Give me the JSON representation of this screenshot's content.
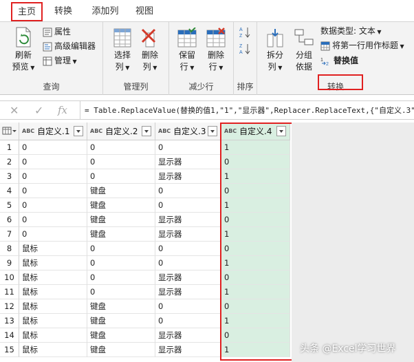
{
  "tabs": [
    "主页",
    "转换",
    "添加列",
    "视图"
  ],
  "ribbon": {
    "query": {
      "refresh_line1": "刷新",
      "refresh_line2": "预览",
      "properties": "属性",
      "advanced_editor": "高级编辑器",
      "manage": "管理",
      "label": "查询"
    },
    "manage_columns": {
      "choose_line1": "选择",
      "choose_line2": "列",
      "remove_line1": "删除",
      "remove_line2": "列",
      "label": "管理列"
    },
    "reduce_rows": {
      "keep_line1": "保留",
      "keep_line2": "行",
      "remove_line1": "删除",
      "remove_line2": "行",
      "label": "减少行"
    },
    "sort": {
      "label": "排序"
    },
    "transform": {
      "split_line1": "拆分",
      "split_line2": "列",
      "group_line1": "分组",
      "group_line2": "依据",
      "data_type": "数据类型: 文本",
      "first_row_header": "将第一行用作标题",
      "replace_values": "替换值",
      "label": "转换"
    }
  },
  "formula_bar": {
    "fx": "fx",
    "formula": "= Table.ReplaceValue(替换的值1,\"1\",\"显示器\",Replacer.ReplaceText,{\"自定义.3\"})"
  },
  "table": {
    "columns": [
      "自定义.1",
      "自定义.2",
      "自定义.3",
      "自定义.4"
    ],
    "type_badge": "ABC",
    "rows": [
      [
        "1",
        "0",
        "0",
        "0",
        "1"
      ],
      [
        "2",
        "0",
        "0",
        "显示器",
        "0"
      ],
      [
        "3",
        "0",
        "0",
        "显示器",
        "1"
      ],
      [
        "4",
        "0",
        "键盘",
        "0",
        "0"
      ],
      [
        "5",
        "0",
        "键盘",
        "0",
        "1"
      ],
      [
        "6",
        "0",
        "键盘",
        "显示器",
        "0"
      ],
      [
        "7",
        "0",
        "键盘",
        "显示器",
        "1"
      ],
      [
        "8",
        "鼠标",
        "0",
        "0",
        "0"
      ],
      [
        "9",
        "鼠标",
        "0",
        "0",
        "1"
      ],
      [
        "10",
        "鼠标",
        "0",
        "显示器",
        "0"
      ],
      [
        "11",
        "鼠标",
        "0",
        "显示器",
        "1"
      ],
      [
        "12",
        "鼠标",
        "键盘",
        "0",
        "0"
      ],
      [
        "13",
        "鼠标",
        "键盘",
        "0",
        "1"
      ],
      [
        "14",
        "鼠标",
        "键盘",
        "显示器",
        "0"
      ],
      [
        "15",
        "鼠标",
        "键盘",
        "显示器",
        "1"
      ]
    ]
  },
  "watermark": "头条 @Excel学习世界",
  "colors": {
    "highlight_border": "#e02020",
    "selected_column_fill": "#d9efe1"
  }
}
